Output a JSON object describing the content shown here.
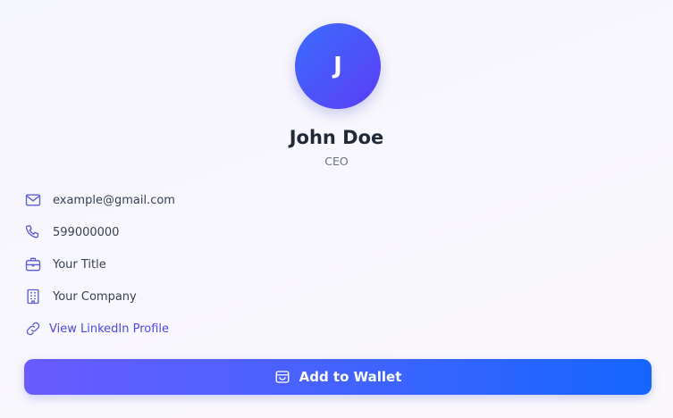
{
  "profile": {
    "initial": "J",
    "name": "John Doe",
    "role": "CEO"
  },
  "details": [
    {
      "icon": "mail-icon",
      "text": "example@gmail.com"
    },
    {
      "icon": "phone-icon",
      "text": "599000000"
    },
    {
      "icon": "briefcase-icon",
      "text": "Your Title"
    },
    {
      "icon": "building-icon",
      "text": "Your Company"
    }
  ],
  "linkedin": {
    "icon": "link-icon",
    "text": "View LinkedIn Profile"
  },
  "wallet_button": {
    "icon": "wallet-icon",
    "label": "Add to Wallet"
  },
  "colors": {
    "accent": "#4f46e5",
    "icon": "#5b5bd6",
    "button_start": "#6a5cff",
    "button_end": "#1565ff"
  }
}
